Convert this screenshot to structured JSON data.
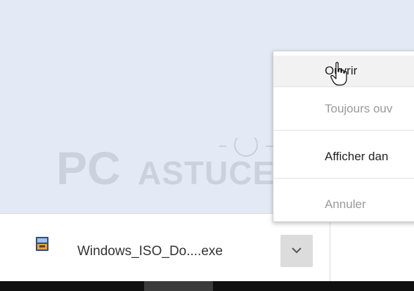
{
  "watermark": {
    "text_pc": "PC",
    "text_astuces": "ASTUCES"
  },
  "download_bar": {
    "file_name": "Windows_ISO_Do....exe",
    "file_icon": "installer-file-icon",
    "menu_button_icon": "chevron-down-icon"
  },
  "context_menu": {
    "items": [
      {
        "label": "Ouvrir",
        "state": "hovered"
      },
      {
        "label": "Toujours ouv",
        "state": "disabled"
      },
      {
        "label": "Afficher dan",
        "state": "enabled"
      },
      {
        "label": "Annuler",
        "state": "disabled"
      }
    ]
  },
  "cursor": {
    "icon": "hand-pointer-cursor"
  },
  "colors": {
    "background": "#e4eaf5",
    "menu_hover": "#f2f2f2",
    "disabled_text": "#9a9a9a",
    "taskbar": "#101010"
  }
}
